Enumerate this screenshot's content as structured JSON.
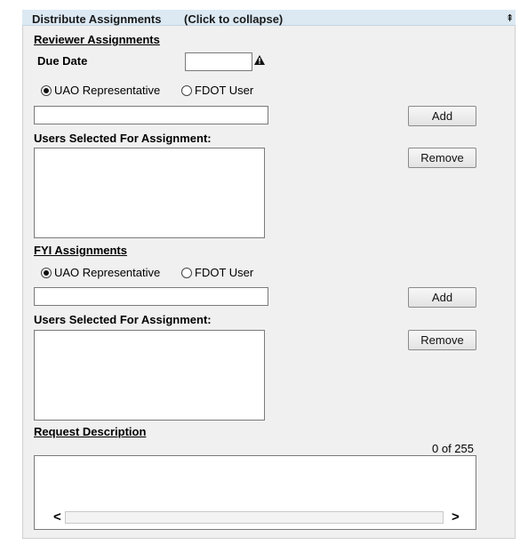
{
  "header": {
    "title": "Distribute Assignments",
    "collapse_hint": "(Click to collapse)",
    "collapse_icon": "⇞"
  },
  "reviewer": {
    "section_title": "Reviewer Assignments",
    "due_date_label": "Due Date",
    "due_date_value": "",
    "warning_icon": "warning-icon",
    "radio_uao_label": "UAO Representative",
    "radio_fdot_label": "FDOT User",
    "selected_option": "UAO Representative",
    "search_value": "",
    "add_label": "Add",
    "users_selected_label": "Users Selected For Assignment:",
    "remove_label": "Remove"
  },
  "fyi": {
    "section_title": "FYI Assignments",
    "radio_uao_label": "UAO Representative",
    "radio_fdot_label": "FDOT User",
    "selected_option": "UAO Representative",
    "search_value": "",
    "add_label": "Add",
    "users_selected_label": "Users Selected For Assignment:",
    "remove_label": "Remove"
  },
  "request": {
    "section_title": "Request Description",
    "char_count": "0 of 255",
    "value": ""
  },
  "scroll": {
    "left_arrow": "<",
    "right_arrow": ">"
  }
}
